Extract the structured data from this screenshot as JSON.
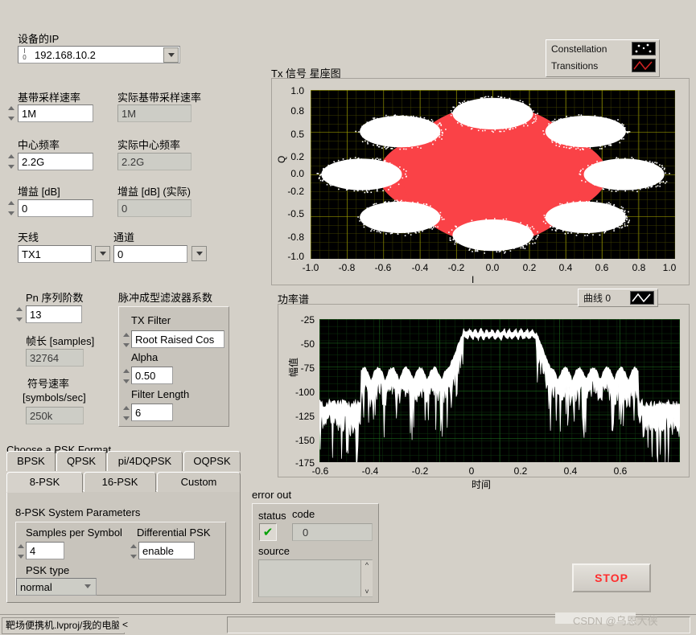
{
  "device": {
    "ip_label": "设备的IP",
    "ip_value": "192.168.10.2",
    "baseband_rate_label": "基带采样速率",
    "baseband_rate_value": "1M",
    "actual_baseband_rate_label": "实际基带采样速率",
    "actual_baseband_rate_value": "1M",
    "center_freq_label": "中心频率",
    "center_freq_value": "2.2G",
    "actual_center_freq_label": "实际中心频率",
    "actual_center_freq_value": "2.2G",
    "gain_label": "增益 [dB]",
    "gain_value": "0",
    "actual_gain_label": "增益 [dB] (实际)",
    "actual_gain_value": "0",
    "antenna_label": "天线",
    "antenna_value": "TX1",
    "channel_label": "通道",
    "channel_value": "0"
  },
  "signal": {
    "pn_order_label": "Pn 序列阶数",
    "pn_order_value": "13",
    "frame_len_label": "帧长 [samples]",
    "frame_len_value": "32764",
    "symbol_rate_label_1": "符号速率",
    "symbol_rate_label_2": "[symbols/sec]",
    "symbol_rate_value": "250k",
    "pulse_shape_label": "脉冲成型滤波器系数",
    "tx_filter_label": "TX Filter",
    "tx_filter_value": "Root Raised Cos",
    "alpha_label": "Alpha",
    "alpha_value": "0.50",
    "filter_length_label": "Filter Length",
    "filter_length_value": "6"
  },
  "psk": {
    "section_label": "Choose a PSK Format",
    "tabs_row1": [
      "BPSK",
      "QPSK",
      "pi/4DQPSK",
      "OQPSK"
    ],
    "tabs_row2": [
      "8-PSK",
      "16-PSK",
      "Custom"
    ],
    "selected_tab": "8-PSK",
    "params_title": "8-PSK System Parameters",
    "samples_per_symbol_label": "Samples per Symbol",
    "samples_per_symbol_value": "4",
    "differential_psk_label": "Differential PSK",
    "differential_psk_value": "enable",
    "psk_type_label": "PSK type",
    "psk_type_value": "normal"
  },
  "error_out": {
    "title": "error out",
    "status_label": "status",
    "status_icon": "check-mark",
    "code_label": "code",
    "code_value": "0",
    "source_label": "source",
    "source_value": ""
  },
  "actions": {
    "stop_label": "STOP"
  },
  "statusbar": {
    "project_path": "靶场便携机.lvproj/我的电脑",
    "arrow": "<",
    "watermark": "CSDN @乌恩大侠"
  },
  "chart_data": [
    {
      "type": "scatter",
      "name": "constellation",
      "title": "Tx 信号 星座图",
      "xlabel": "I",
      "ylabel": "Q",
      "xlim": [
        -1.0,
        1.0
      ],
      "ylim": [
        -1.0,
        1.0
      ],
      "xticks": [
        "-1.0",
        "-0.8",
        "-0.6",
        "-0.4",
        "-0.2",
        "0.0",
        "0.2",
        "0.4",
        "0.6",
        "0.8",
        "1.0"
      ],
      "yticks": [
        "1.0",
        "0.8",
        "0.5",
        "0.2",
        "0.0",
        "-0.2",
        "-0.5",
        "-0.8",
        "-1.0"
      ],
      "grid": true,
      "grid_color": "#b3b300",
      "background": "#000000",
      "legend_position": "top-right",
      "legend": [
        {
          "name": "Constellation",
          "color": "#ffffff",
          "style": "dots"
        },
        {
          "name": "Transitions",
          "color": "#cc2222",
          "style": "line"
        }
      ],
      "modulation": "8-PSK",
      "symbol_radius": 0.72,
      "cluster_spread": 0.085,
      "symbol_points": [
        {
          "i": 0.72,
          "q": 0.0
        },
        {
          "i": 0.509,
          "q": 0.509
        },
        {
          "i": 0.0,
          "q": 0.72
        },
        {
          "i": -0.509,
          "q": 0.509
        },
        {
          "i": -0.72,
          "q": 0.0
        },
        {
          "i": -0.509,
          "q": -0.509
        },
        {
          "i": 0.0,
          "q": -0.72
        },
        {
          "i": 0.509,
          "q": -0.509
        }
      ],
      "transition_fill": "#fa4247"
    },
    {
      "type": "line",
      "name": "power-spectrum",
      "title": "功率谱",
      "xlabel": "时间",
      "ylabel": "幅值",
      "xlim": [
        -0.65,
        0.65
      ],
      "ylim": [
        -180,
        -20
      ],
      "xticks": [
        "-0.6",
        "-0.4",
        "-0.2",
        "0",
        "0.2",
        "0.4",
        "0.6"
      ],
      "yticks": [
        "-25",
        "-50",
        "-75",
        "-100",
        "-125",
        "-150",
        "-175"
      ],
      "grid": true,
      "grid_color": "#1f7a1f",
      "background": "#000000",
      "trace_color": "#ffffff",
      "legend_position": "top-right",
      "legend": [
        {
          "name": "曲线 0",
          "color": "#ffffff",
          "style": "line"
        }
      ],
      "passband_level_db": -35,
      "passband_range": [
        -0.13,
        0.13
      ],
      "sidelobe_level_db": -90,
      "noise_floor_db": -110
    }
  ]
}
